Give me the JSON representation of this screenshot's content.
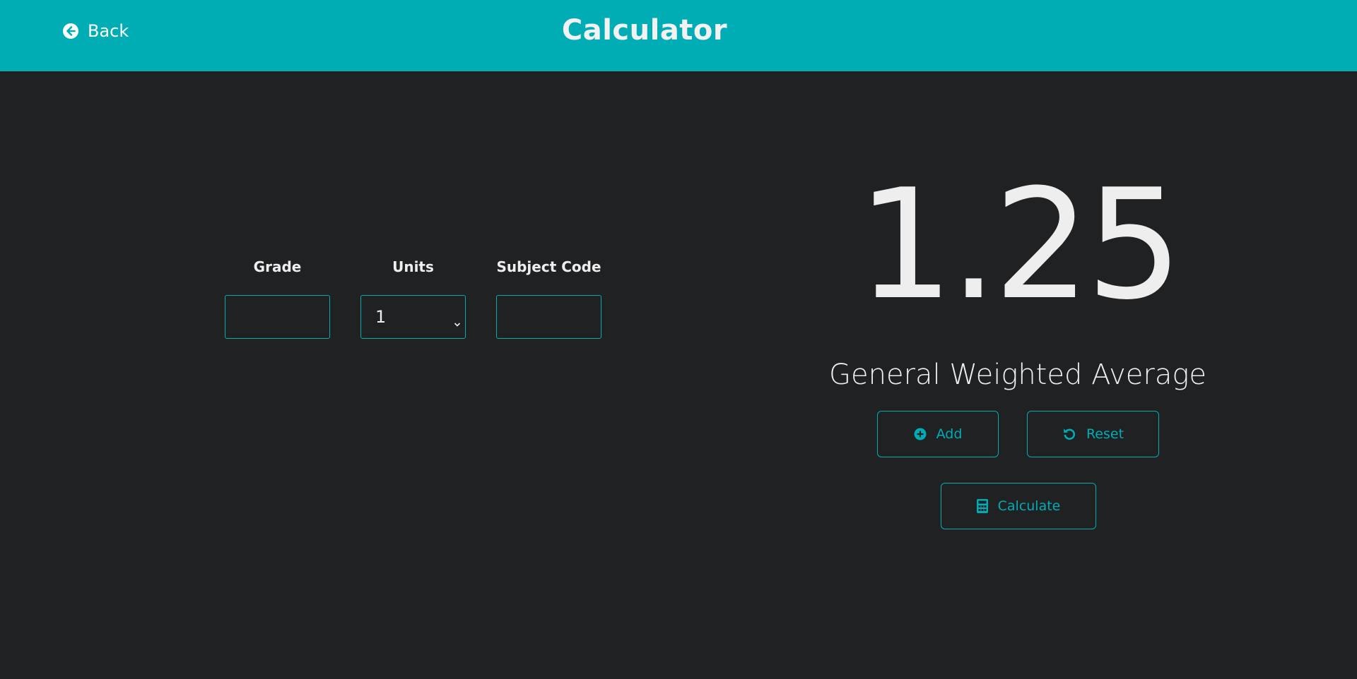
{
  "header": {
    "back_label": "Back",
    "back_icon": "arrow-circle-left-icon",
    "title": "Calculator",
    "background_color": "#00adb5"
  },
  "form": {
    "grade_label": "Grade",
    "grade_value": "",
    "units_label": "Units",
    "units_selected": "1",
    "subject_code_label": "Subject Code",
    "subject_code_value": ""
  },
  "result": {
    "value": "1.25",
    "label": "General Weighted Average"
  },
  "actions": {
    "add_label": "Add",
    "add_icon": "plus-circle-icon",
    "reset_label": "Reset",
    "reset_icon": "undo-icon",
    "calculate_label": "Calculate",
    "calculate_icon": "calculator-icon"
  },
  "colors": {
    "accent": "#00adb5",
    "background": "#1f2123",
    "text": "#eeeeee"
  }
}
